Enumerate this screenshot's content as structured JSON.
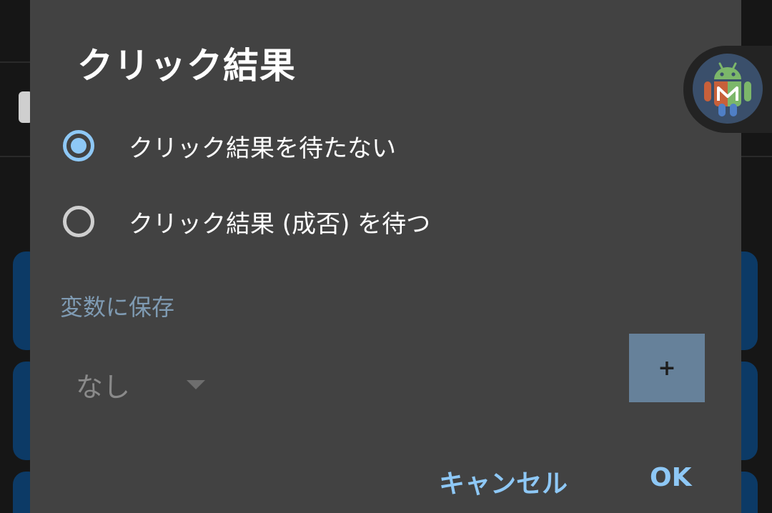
{
  "dialog": {
    "title": "クリック結果",
    "options": [
      {
        "label": "クリック結果を待たない",
        "selected": true
      },
      {
        "label": "クリック結果 (成否) を待つ",
        "selected": false
      }
    ],
    "section_label": "変数に保存",
    "variable_dropdown": {
      "selected": "なし"
    },
    "add_button_label": "+",
    "cancel_label": "キャンセル",
    "ok_label": "OK"
  },
  "overlay": {
    "icon": "android-robot-icon"
  },
  "colors": {
    "dialog_bg": "#424242",
    "accent": "#8ec8f6",
    "section_label": "#7f9bb3",
    "add_button_bg": "#66819a"
  }
}
